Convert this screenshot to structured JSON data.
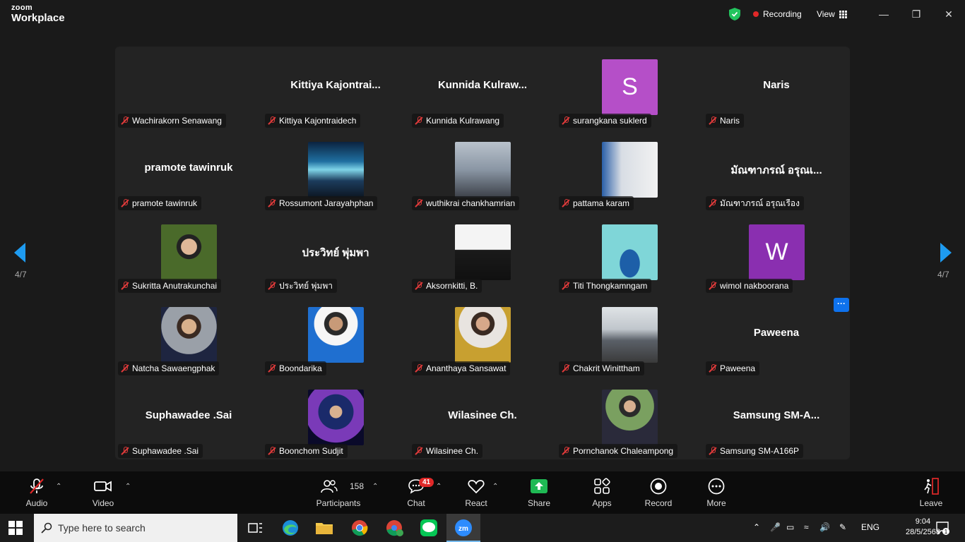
{
  "titlebar": {
    "logo_top": "zoom",
    "logo_bottom": "Workplace",
    "recording": "Recording",
    "view": "View"
  },
  "gallery": {
    "page_left": "4/7",
    "page_right": "4/7",
    "more": "···",
    "tiles": [
      {
        "label": "Wachirakorn Senawang",
        "display": "",
        "kind": "blank"
      },
      {
        "label": "Kittiya Kajontraidech",
        "display": "Kittiya  Kajontrai...",
        "kind": "name"
      },
      {
        "label": "Kunnida Kulrawang",
        "display": "Kunnida  Kulraw...",
        "kind": "name"
      },
      {
        "label": "surangkana suklerd",
        "display": "S",
        "kind": "avatar",
        "color": "#b54fc8"
      },
      {
        "label": "Naris",
        "display": "Naris",
        "kind": "name"
      },
      {
        "label": "pramote tawinruk",
        "display": "pramote tawinruk",
        "kind": "name"
      },
      {
        "label": "Rossumont Jarayahphan",
        "display": "",
        "kind": "photo",
        "photo": "aurora-photo"
      },
      {
        "label": "wuthikrai chankhamrian",
        "display": "",
        "kind": "photo",
        "photo": "office-photo"
      },
      {
        "label": "pattama karam",
        "display": "",
        "kind": "photo",
        "photo": "woman-photo"
      },
      {
        "label": "มัณฑาภรณ์ อรุณเรือง",
        "display": "มัณฑาภรณ์ อรุณเ...",
        "kind": "name"
      },
      {
        "label": "Sukritta Anutrakunchai",
        "display": "",
        "kind": "photo",
        "photo": "garden-photo"
      },
      {
        "label": "ประวิทย์ พุ่มพา",
        "display": "ประวิทย์ พุ่มพา",
        "kind": "name"
      },
      {
        "label": "Aksornkitti, B.",
        "display": "",
        "kind": "photo",
        "photo": "suit-photo"
      },
      {
        "label": "Titi Thongkamngam",
        "display": "",
        "kind": "photo",
        "photo": "whale-photo"
      },
      {
        "label": "wimol nakboorana",
        "display": "W",
        "kind": "avatar",
        "color": "#8a2fb0"
      },
      {
        "label": "Natcha Sawaengphak",
        "display": "",
        "kind": "photo",
        "photo": "portrait-photo"
      },
      {
        "label": "Boondarika",
        "display": "",
        "kind": "photo",
        "photo": "blue-jacket-photo"
      },
      {
        "label": "Ananthaya Sansawat",
        "display": "",
        "kind": "photo",
        "photo": "floral-photo"
      },
      {
        "label": "Chakrit Winittham",
        "display": "",
        "kind": "photo",
        "photo": "standing-photo"
      },
      {
        "label": "Paweena",
        "display": "Paweena",
        "kind": "name"
      },
      {
        "label": "Suphawadee .Sai",
        "display": "Suphawadee .Sai",
        "kind": "name"
      },
      {
        "label": "Boonchom Sudjit",
        "display": "",
        "kind": "photo",
        "photo": "space-photo"
      },
      {
        "label": "Wilasinee Ch.",
        "display": "Wilasinee Ch.",
        "kind": "name"
      },
      {
        "label": "Pornchanok Chaleampong",
        "display": "",
        "kind": "photo",
        "photo": "outdoor-photo"
      },
      {
        "label": "Samsung SM-A166P",
        "display": "Samsung  SM-A...",
        "kind": "name"
      }
    ]
  },
  "toolbar": {
    "audio": "Audio",
    "video": "Video",
    "participants": "Participants",
    "participants_count": "158",
    "chat": "Chat",
    "chat_badge": "41",
    "react": "React",
    "share": "Share",
    "apps": "Apps",
    "record": "Record",
    "more": "More",
    "leave": "Leave"
  },
  "taskbar": {
    "search_placeholder": "Type here to search",
    "lang": "ENG",
    "time": "9:04",
    "date": "28/5/2568",
    "notif_count": "1"
  }
}
